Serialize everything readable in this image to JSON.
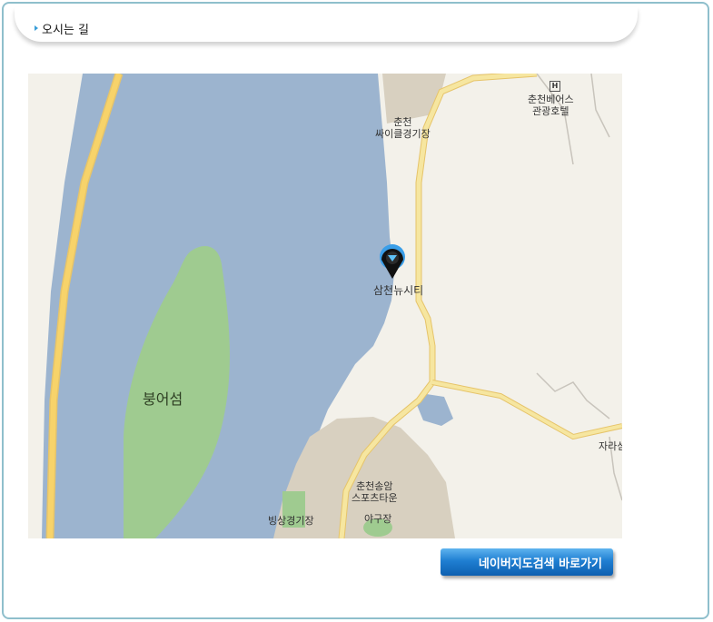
{
  "section": {
    "title": "오시는 길"
  },
  "map": {
    "labels": {
      "cycle_stadium": [
        "춘천",
        "싸이클경기장"
      ],
      "hotel_icon": "H",
      "hotel": [
        "춘천베어스",
        "관광호텔"
      ],
      "marker": "삼천뉴시티",
      "island": "붕어섬",
      "sports_town": [
        "춘천송암",
        "스포츠타운"
      ],
      "ice_rink": "빙상경기장",
      "baseball": "야구장",
      "edge_right": "자라섬"
    },
    "colors": {
      "water": "#9cb4cf",
      "land": "#f3f1ea",
      "park": "#9fcb90",
      "road": "#f6e6a0",
      "road_edge": "#e6c46a",
      "highway": "#f7d36a",
      "urban": "#d8d0c0"
    }
  },
  "actions": {
    "naver_button": "네이버지도검색 바로가기"
  }
}
